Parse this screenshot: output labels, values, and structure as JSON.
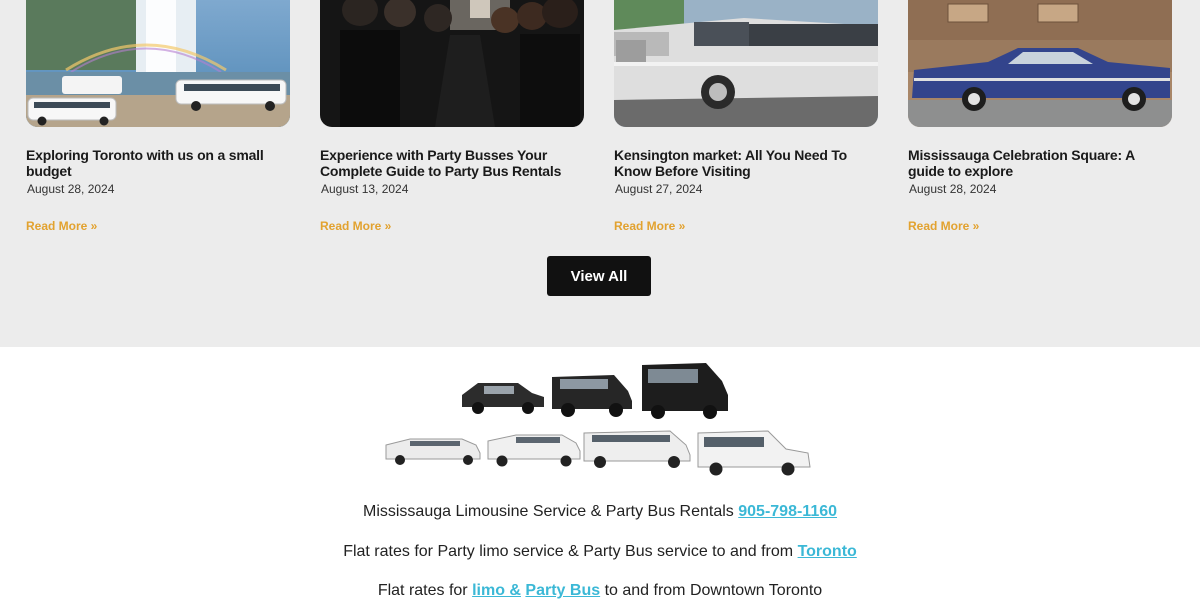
{
  "blog": {
    "posts": [
      {
        "title": "Exploring Toronto with us on a small budget",
        "date": "August 28, 2024",
        "read_more": "Read More »",
        "image": "niagara-falls-limousines"
      },
      {
        "title": "Experience with Party Busses Your Complete Guide to Party Bus Rentals",
        "date": "August 13, 2024",
        "read_more": "Read More »",
        "image": "party-bus-interior"
      },
      {
        "title": "Kensington market: All You Need To Know Before Visiting",
        "date": "August 27, 2024",
        "read_more": "Read More »",
        "image": "white-cadillac-limousine"
      },
      {
        "title": "Mississauga Celebration Square: A guide to explore",
        "date": "August 28, 2024",
        "read_more": "Read More »",
        "image": "blue-vintage-cadillac"
      }
    ],
    "view_all_label": "View All"
  },
  "footer": {
    "fleet_image": "limousine-fleet-lineup",
    "line1": {
      "text": "Mississauga Limousine Service  & Party Bus Rentals ",
      "phone": "905-798-1160"
    },
    "line2": {
      "text": "Flat rates for Party limo service & Party Bus service to and from ",
      "link": "Toronto"
    },
    "line3": {
      "prefix": "Flat rates for ",
      "link1": " limo &",
      "link2": "Party Bus",
      "suffix": " to and from Downtown Toronto"
    }
  },
  "colors": {
    "accent": "#e2a22f",
    "link": "#3bb8d6",
    "button_bg": "#111111",
    "section_bg": "#ececec"
  }
}
